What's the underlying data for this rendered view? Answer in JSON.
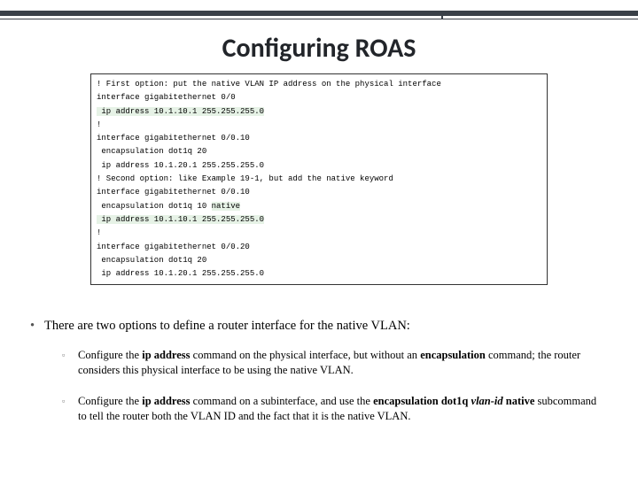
{
  "title": "Configuring ROAS",
  "code": {
    "l1": "! First option: put the native VLAN IP address on the physical interface",
    "l2": "interface gigabitethernet 0/0",
    "l3": " ip address 10.1.10.1 255.255.255.0",
    "l4": "!",
    "l5": "interface gigabitethernet 0/0.10",
    "l6": " encapsulation dot1q 20",
    "l7": " ip address 10.1.20.1 255.255.255.0",
    "l8": "! Second option: like Example 19-1, but add the native keyword",
    "l9": "interface gigabitethernet 0/0.10",
    "l10a": " encapsulation dot1q 10 ",
    "l10b": "native",
    "l11": " ip address 10.1.10.1 255.255.255.0",
    "l12": "!",
    "l13": "interface gigabitethernet 0/0.20",
    "l14": " encapsulation dot1q 20",
    "l15": " ip address 10.1.20.1 255.255.255.0"
  },
  "bullets": {
    "main": "There are two options to define a router interface for the native VLAN:",
    "sub1_a": "Configure the ",
    "sub1_b": "ip address",
    "sub1_c": " command on the physical interface, but without an ",
    "sub1_d": "encapsulation",
    "sub1_e": " command; the router considers this physical interface to be using the native VLAN.",
    "sub2_a": "Configure the ",
    "sub2_b": "ip address",
    "sub2_c": " command on a subinterface, and use the ",
    "sub2_d": "encapsulation dot1q ",
    "sub2_e": "vlan-id",
    "sub2_f": " native",
    "sub2_g": " subcommand to tell the router both the VLAN ID and the fact that it is the native VLAN."
  }
}
